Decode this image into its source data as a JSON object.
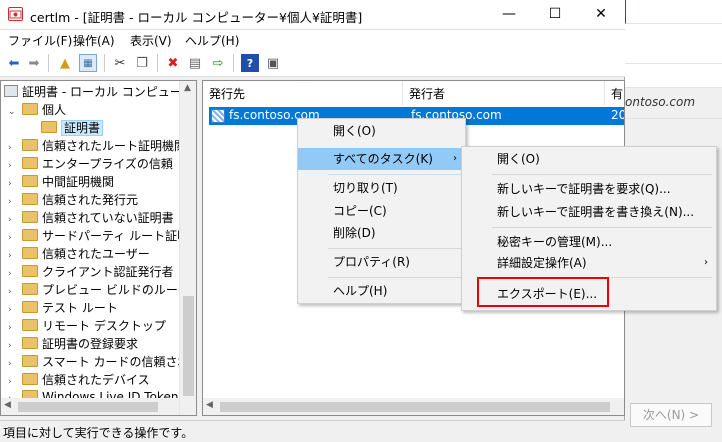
{
  "window": {
    "title": "certlm - [証明書 - ローカル コンピューター¥個人¥証明書]",
    "minimize": "—",
    "maximize": "☐",
    "close": "✕"
  },
  "menubar": [
    "ファイル(F)",
    "操作(A)",
    "表示(V)",
    "ヘルプ(H)"
  ],
  "tree": {
    "root": "証明書 - ローカル コンピューター",
    "items": [
      {
        "label": "個人",
        "expanded": true
      },
      {
        "label": "証明書"
      },
      {
        "label": "信頼されたルート証明機関"
      },
      {
        "label": "エンタープライズの信頼"
      },
      {
        "label": "中間証明機関"
      },
      {
        "label": "信頼された発行元"
      },
      {
        "label": "信頼されていない証明書"
      },
      {
        "label": "サードパーティ ルート証明機関"
      },
      {
        "label": "信頼されたユーザー"
      },
      {
        "label": "クライアント認証発行者"
      },
      {
        "label": "プレビュー ビルドのルート"
      },
      {
        "label": "テスト ルート"
      },
      {
        "label": "リモート デスクトップ"
      },
      {
        "label": "証明書の登録要求"
      },
      {
        "label": "スマート カードの信頼されたルー"
      },
      {
        "label": "信頼されたデバイス"
      },
      {
        "label": "Windows Live ID Token Iss"
      }
    ]
  },
  "list": {
    "columns": [
      "発行先",
      "発行者",
      "有"
    ],
    "rows": [
      {
        "issued_to": "fs.contoso.com",
        "issued_by": "fs.contoso.com",
        "exp": "20"
      }
    ]
  },
  "context_menu": {
    "items": [
      "開く(O)",
      "すべてのタスク(K)",
      "切り取り(T)",
      "コピー(C)",
      "削除(D)",
      "プロパティ(R)",
      "ヘルプ(H)"
    ]
  },
  "submenu": {
    "items": [
      "開く(O)",
      "新しいキーで証明書を要求(Q)...",
      "新しいキーで証明書を書き換え(N)...",
      "秘密キーの管理(M)...",
      "詳細設定操作(A)",
      "エクスポート(E)..."
    ]
  },
  "status": "項目に対して実行できる操作です。",
  "background_window": {
    "text": "ontoso.com",
    "next_button": "次へ(N) >"
  },
  "colors": {
    "selection": "#0078d7",
    "highlight_box": "#e00000"
  }
}
